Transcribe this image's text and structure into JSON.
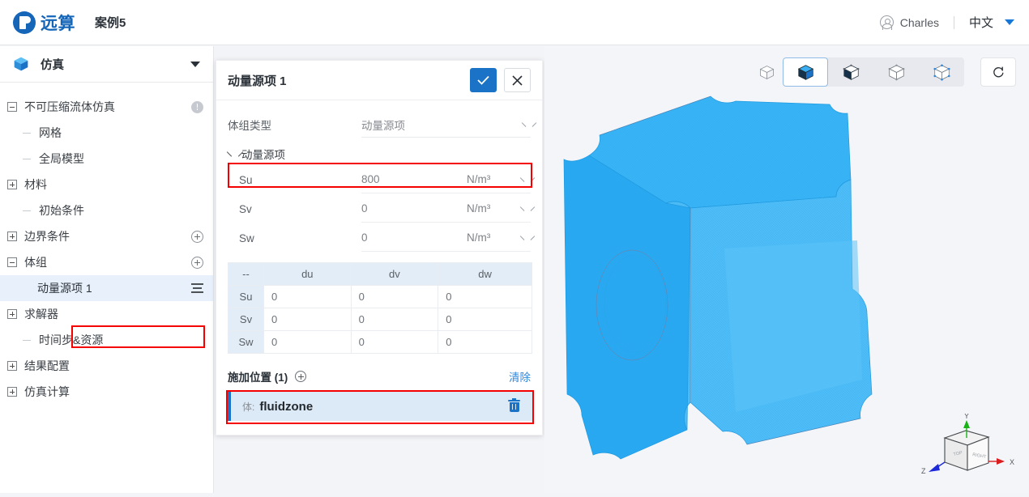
{
  "topbar": {
    "logo_icon": "yuansuan-logo-icon",
    "brand": "远算",
    "case_name": "案例5",
    "avatar_icon": "user-avatar-icon",
    "user": "Charles",
    "language": "中文",
    "lang_caret_icon": "caret-down-icon",
    "accent": "#1565b8"
  },
  "sidebar": {
    "header": {
      "icon": "cube-icon",
      "title": "仿真",
      "caret_icon": "caret-down-icon"
    },
    "tree": [
      {
        "label": "不可压缩流体仿真",
        "depth": 1,
        "toggle": "minus",
        "right_icon": "warning-icon",
        "selected": false
      },
      {
        "label": "网格",
        "depth": 2,
        "toggle": "line",
        "right_icon": "",
        "selected": false
      },
      {
        "label": "全局模型",
        "depth": 2,
        "toggle": "line",
        "right_icon": "",
        "selected": false
      },
      {
        "label": "材料",
        "depth": 1,
        "toggle": "plus",
        "right_icon": "",
        "selected": false
      },
      {
        "label": "初始条件",
        "depth": 2,
        "toggle": "line",
        "right_icon": "",
        "selected": false
      },
      {
        "label": "边界条件",
        "depth": 1,
        "toggle": "plus",
        "right_icon": "plus-circle-icon",
        "selected": false
      },
      {
        "label": "体组",
        "depth": 1,
        "toggle": "plus-open",
        "right_icon": "plus-circle-icon",
        "selected": false
      },
      {
        "label": "动量源项 1",
        "depth": 3,
        "toggle": "corner",
        "right_icon": "list-menu-icon",
        "selected": true
      },
      {
        "label": "求解器",
        "depth": 1,
        "toggle": "plus",
        "right_icon": "",
        "selected": false
      },
      {
        "label": "时间步&资源",
        "depth": 2,
        "toggle": "line",
        "right_icon": "",
        "selected": false
      },
      {
        "label": "结果配置",
        "depth": 1,
        "toggle": "plus",
        "right_icon": "",
        "selected": false
      },
      {
        "label": "仿真计算",
        "depth": 1,
        "toggle": "plus",
        "right_icon": "",
        "selected": false
      }
    ]
  },
  "panel": {
    "title": "动量源项 1",
    "confirm_icon": "check-icon",
    "cancel_icon": "close-icon",
    "type_field": {
      "label": "体组类型",
      "value": "动量源项",
      "caret_icon": "chevron-down-icon"
    },
    "section": {
      "label": "动量源项",
      "caret_icon": "chevron-down-icon"
    },
    "params": [
      {
        "name": "Su",
        "value": "800",
        "unit": "N/m³",
        "caret_icon": "chevron-down-icon",
        "highlighted": true
      },
      {
        "name": "Sv",
        "value": "0",
        "unit": "N/m³",
        "caret_icon": "chevron-down-icon",
        "highlighted": false
      },
      {
        "name": "Sw",
        "value": "0",
        "unit": "N/m³",
        "caret_icon": "chevron-down-icon",
        "highlighted": false
      }
    ],
    "matrix": {
      "columns": [
        "--",
        "du",
        "dv",
        "dw"
      ],
      "rows": [
        {
          "head": "Su",
          "cells": [
            "0",
            "0",
            "0"
          ]
        },
        {
          "head": "Sv",
          "cells": [
            "0",
            "0",
            "0"
          ]
        },
        {
          "head": "Sw",
          "cells": [
            "0",
            "0",
            "0"
          ]
        }
      ]
    },
    "location": {
      "title": "施加位置 (1)",
      "add_icon": "plus-circle-icon",
      "clear_label": "清除",
      "item": {
        "kind": "体:",
        "name": "fluidzone",
        "delete_icon": "trash-icon"
      }
    }
  },
  "viewport": {
    "toolbar": {
      "standalone_icon": "wireframe-cube-icon",
      "modes": [
        {
          "icon": "cube-solid-shaded-icon",
          "active": false
        },
        {
          "icon": "cube-solid-icon",
          "active": true
        },
        {
          "icon": "cube-surface-edges-icon",
          "active": false
        },
        {
          "icon": "cube-wireframe-icon",
          "active": false
        },
        {
          "icon": "cube-points-icon",
          "active": false
        }
      ],
      "reset_icon": "reset-view-icon"
    },
    "gizmo": {
      "axis_x": "X",
      "axis_y": "Y",
      "axis_z": "Z",
      "face_top": "TOP",
      "face_right": "RIGHT",
      "color_x": "#d81e1e",
      "color_y": "#17b317",
      "color_z": "#1b29d8"
    },
    "mesh_color": "#27a7f0",
    "background": "#f4f5f8"
  }
}
